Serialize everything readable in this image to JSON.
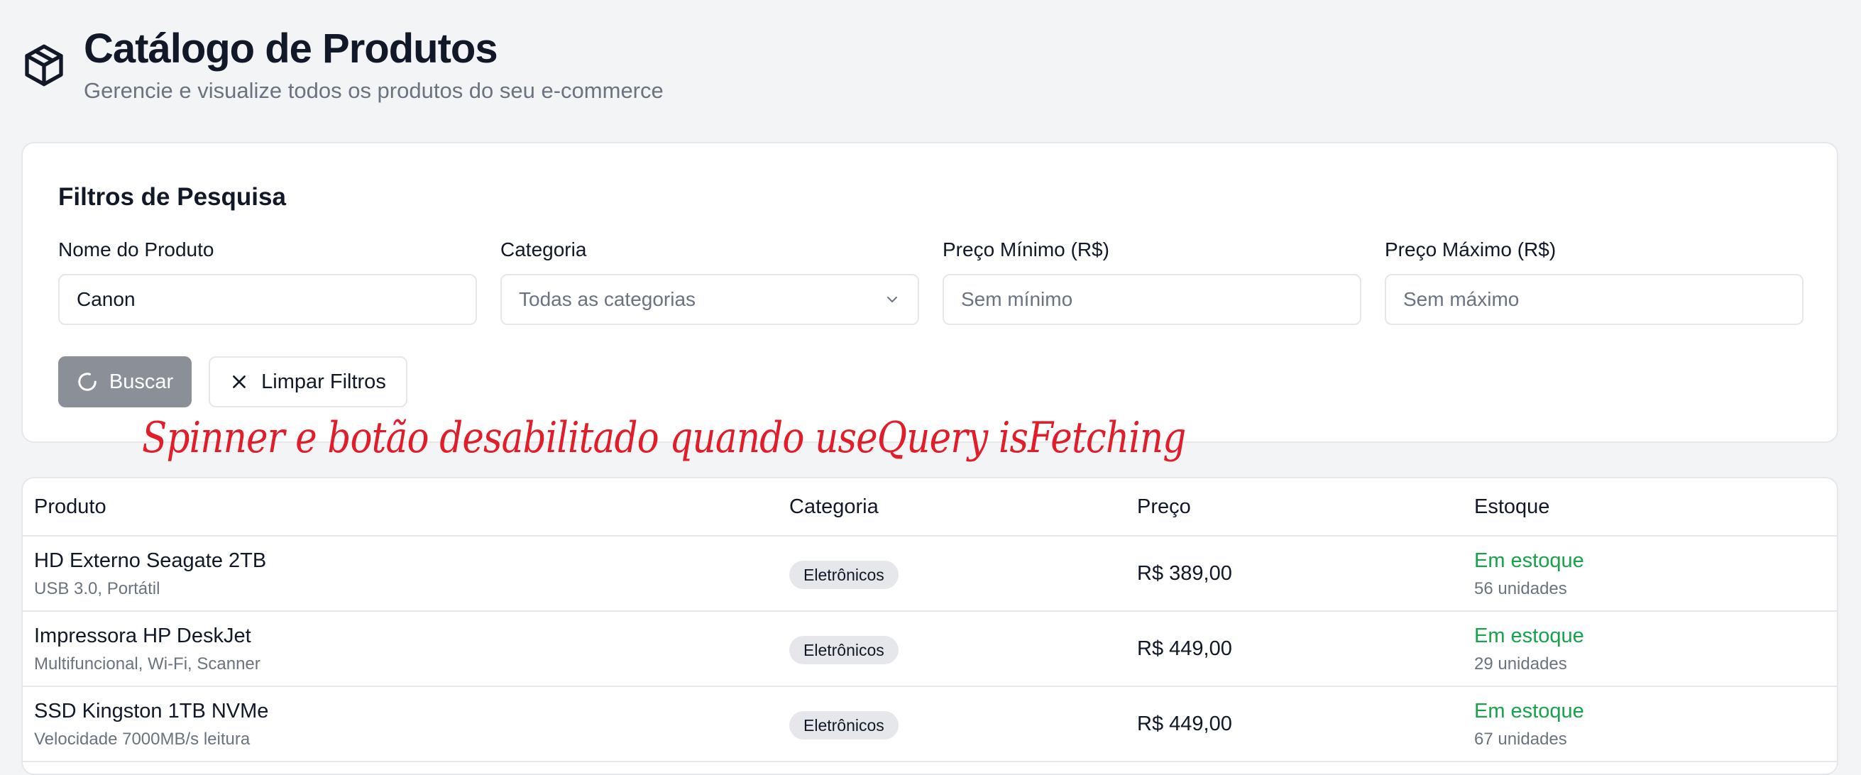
{
  "header": {
    "title": "Catálogo de Produtos",
    "subtitle": "Gerencie e visualize todos os produtos do seu e-commerce",
    "icon": "package-icon"
  },
  "filters": {
    "title": "Filtros de Pesquisa",
    "name_label": "Nome do Produto",
    "name_value": "Canon",
    "category_label": "Categoria",
    "category_value": "Todas as categorias",
    "min_label": "Preço Mínimo (R$)",
    "min_placeholder": "Sem mínimo",
    "max_label": "Preço Máximo (R$)",
    "max_placeholder": "Sem máximo",
    "search_label": "Buscar",
    "clear_label": "Limpar Filtros"
  },
  "annotation": "Spinner e botão desabilitado quando useQuery isFetching",
  "table": {
    "headers": [
      "Produto",
      "Categoria",
      "Preço",
      "Estoque"
    ],
    "rows": [
      {
        "name": "HD Externo Seagate 2TB",
        "desc": "USB 3.0, Portátil",
        "category": "Eletrônicos",
        "price": "R$ 389,00",
        "stock": "Em estoque",
        "units": "56 unidades"
      },
      {
        "name": "Impressora HP DeskJet",
        "desc": "Multifuncional, Wi-Fi, Scanner",
        "category": "Eletrônicos",
        "price": "R$ 449,00",
        "stock": "Em estoque",
        "units": "29 unidades"
      },
      {
        "name": "SSD Kingston 1TB NVMe",
        "desc": "Velocidade 7000MB/s leitura",
        "category": "Eletrônicos",
        "price": "R$ 449,00",
        "stock": "Em estoque",
        "units": "67 unidades"
      }
    ]
  },
  "colors": {
    "stock_green": "#16a34a",
    "annotation_red": "#e11d2a",
    "disabled_button": "#8a8f98"
  }
}
